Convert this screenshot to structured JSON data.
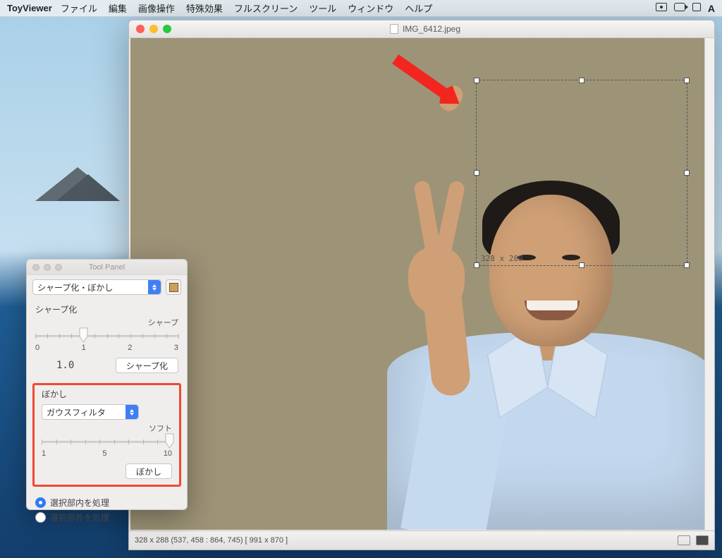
{
  "menubar": {
    "app": "ToyViewer",
    "items": [
      "ファイル",
      "編集",
      "画像操作",
      "特殊効果",
      "フルスクリーン",
      "ツール",
      "ウィンドウ",
      "ヘルプ"
    ]
  },
  "image_window": {
    "filename": "IMG_6412.jpeg",
    "selection_label": "328 x 288",
    "status": "328 x 288  (537, 458 : 864, 745)  [ 991 x 870 ]"
  },
  "tool_panel": {
    "title": "Tool Panel",
    "mode_select": "シャープ化・ぼかし",
    "sharpen": {
      "heading": "シャープ化",
      "right_label": "シャープ",
      "scale": [
        "0",
        "1",
        "2",
        "3"
      ],
      "value": "1.0",
      "button": "シャープ化"
    },
    "blur": {
      "heading": "ぼかし",
      "filter_select": "ガウスフィルタ",
      "right_label": "ソフト",
      "scale": [
        "1",
        "5",
        "10"
      ],
      "button": "ぼかし"
    },
    "radios": {
      "inside": "選択部内を処理",
      "outside": "選択部外を処理"
    }
  }
}
